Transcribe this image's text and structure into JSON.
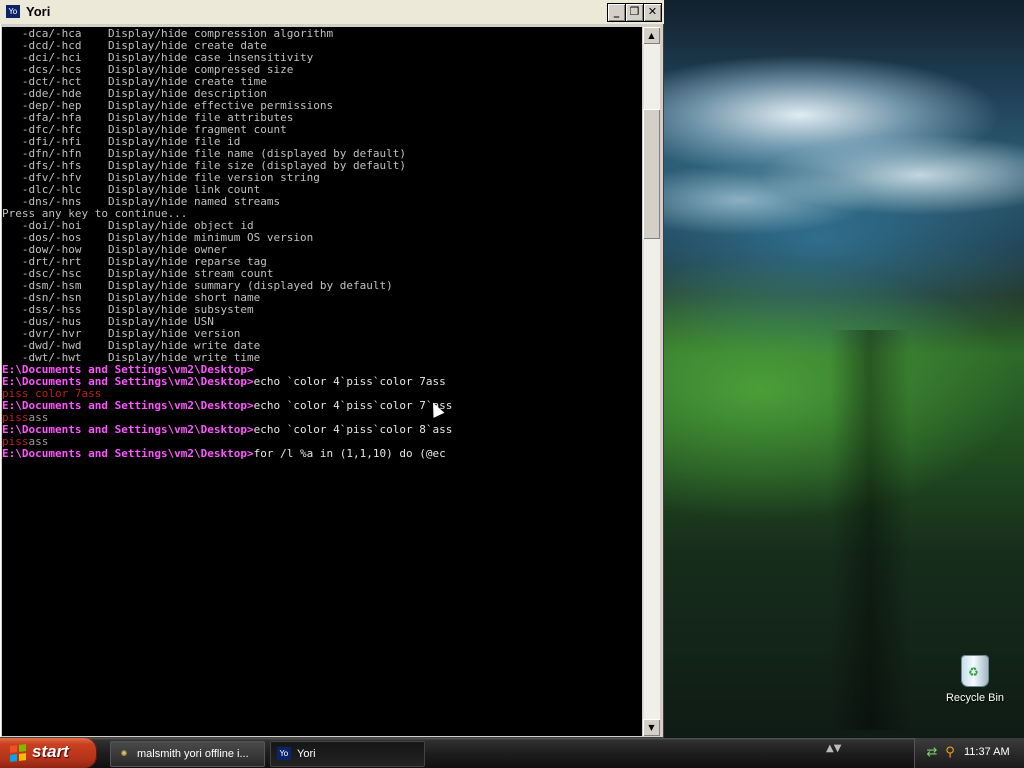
{
  "window": {
    "title": "Yori",
    "icon": "yori-app-icon",
    "minimize_glyph": "_",
    "restore_glyph": "❐",
    "close_glyph": "✕"
  },
  "console": {
    "lines": [
      {
        "parts": [
          {
            "t": "   -dca/-hca    Display/hide compression algorithm",
            "c": "out"
          }
        ]
      },
      {
        "parts": [
          {
            "t": "   -dcd/-hcd    Display/hide create date",
            "c": "out"
          }
        ]
      },
      {
        "parts": [
          {
            "t": "   -dci/-hci    Display/hide case insensitivity",
            "c": "out"
          }
        ]
      },
      {
        "parts": [
          {
            "t": "   -dcs/-hcs    Display/hide compressed size",
            "c": "out"
          }
        ]
      },
      {
        "parts": [
          {
            "t": "   -dct/-hct    Display/hide create time",
            "c": "out"
          }
        ]
      },
      {
        "parts": [
          {
            "t": "   -dde/-hde    Display/hide description",
            "c": "out"
          }
        ]
      },
      {
        "parts": [
          {
            "t": "   -dep/-hep    Display/hide effective permissions",
            "c": "out"
          }
        ]
      },
      {
        "parts": [
          {
            "t": "   -dfa/-hfa    Display/hide file attributes",
            "c": "out"
          }
        ]
      },
      {
        "parts": [
          {
            "t": "   -dfc/-hfc    Display/hide fragment count",
            "c": "out"
          }
        ]
      },
      {
        "parts": [
          {
            "t": "   -dfi/-hfi    Display/hide file id",
            "c": "out"
          }
        ]
      },
      {
        "parts": [
          {
            "t": "   -dfn/-hfn    Display/hide file name (displayed by default)",
            "c": "out"
          }
        ]
      },
      {
        "parts": [
          {
            "t": "   -dfs/-hfs    Display/hide file size (displayed by default)",
            "c": "out"
          }
        ]
      },
      {
        "parts": [
          {
            "t": "   -dfv/-hfv    Display/hide file version string",
            "c": "out"
          }
        ]
      },
      {
        "parts": [
          {
            "t": "   -dlc/-hlc    Display/hide link count",
            "c": "out"
          }
        ]
      },
      {
        "parts": [
          {
            "t": "   -dns/-hns    Display/hide named streams",
            "c": "out"
          }
        ]
      },
      {
        "parts": [
          {
            "t": "Press any key to continue...",
            "c": "out"
          }
        ]
      },
      {
        "parts": [
          {
            "t": "   -doi/-hoi    Display/hide object id",
            "c": "out"
          }
        ]
      },
      {
        "parts": [
          {
            "t": "   -dos/-hos    Display/hide minimum OS version",
            "c": "out"
          }
        ]
      },
      {
        "parts": [
          {
            "t": "   -dow/-how    Display/hide owner",
            "c": "out"
          }
        ]
      },
      {
        "parts": [
          {
            "t": "   -drt/-hrt    Display/hide reparse tag",
            "c": "out"
          }
        ]
      },
      {
        "parts": [
          {
            "t": "   -dsc/-hsc    Display/hide stream count",
            "c": "out"
          }
        ]
      },
      {
        "parts": [
          {
            "t": "   -dsm/-hsm    Display/hide summary (displayed by default)",
            "c": "out"
          }
        ]
      },
      {
        "parts": [
          {
            "t": "   -dsn/-hsn    Display/hide short name",
            "c": "out"
          }
        ]
      },
      {
        "parts": [
          {
            "t": "   -dss/-hss    Display/hide subsystem",
            "c": "out"
          }
        ]
      },
      {
        "parts": [
          {
            "t": "   -dus/-hus    Display/hide USN",
            "c": "out"
          }
        ]
      },
      {
        "parts": [
          {
            "t": "   -dvr/-hvr    Display/hide version",
            "c": "out"
          }
        ]
      },
      {
        "parts": [
          {
            "t": "   -dwd/-hwd    Display/hide write date",
            "c": "out"
          }
        ]
      },
      {
        "parts": [
          {
            "t": "   -dwt/-hwt    Display/hide write time",
            "c": "out"
          }
        ]
      },
      {
        "parts": [
          {
            "t": "E:\\Documents and Settings\\vm2\\Desktop>",
            "c": "prompt"
          }
        ]
      },
      {
        "parts": [
          {
            "t": "E:\\Documents and Settings\\vm2\\Desktop>",
            "c": "prompt"
          },
          {
            "t": "echo `color 4`piss`color 7ass",
            "c": "cmd"
          }
        ]
      },
      {
        "parts": [
          {
            "t": "piss color 7ass",
            "c": "red"
          }
        ]
      },
      {
        "parts": [
          {
            "t": "E:\\Documents and Settings\\vm2\\Desktop>",
            "c": "prompt"
          },
          {
            "t": "echo `color 4`piss`color 7`ass",
            "c": "cmd"
          }
        ]
      },
      {
        "parts": [
          {
            "t": "piss",
            "c": "red"
          },
          {
            "t": "ass",
            "c": "grey"
          }
        ]
      },
      {
        "parts": [
          {
            "t": "E:\\Documents and Settings\\vm2\\Desktop>",
            "c": "prompt"
          },
          {
            "t": "echo `color 4`piss`color 8`ass",
            "c": "cmd"
          }
        ]
      },
      {
        "parts": [
          {
            "t": "piss",
            "c": "red"
          },
          {
            "t": "ass",
            "c": "grey"
          }
        ]
      },
      {
        "parts": [
          {
            "t": "E:\\Documents and Settings\\vm2\\Desktop>",
            "c": "prompt"
          },
          {
            "t": "for /l %a in (1,1,10) do (@ec",
            "c": "cmd"
          }
        ]
      }
    ]
  },
  "scrollbar": {
    "up_glyph": "▲",
    "down_glyph": "▼"
  },
  "desktop": {
    "recycle_bin_label": "Recycle Bin",
    "recycle_bin_icon": "recycle-bin-icon"
  },
  "taskbar": {
    "start_label": "start",
    "tasks": [
      {
        "label": "malsmith yori offline i...",
        "icon": "browser-icon",
        "glyph": "✺",
        "active": false
      },
      {
        "label": "Yori",
        "icon": "yori-app-icon",
        "glyph": "Yo",
        "active": true
      }
    ],
    "tray_icons": [
      {
        "name": "network-icon",
        "glyph": "⇄",
        "color": "#7fd06f"
      },
      {
        "name": "search-icon",
        "glyph": "⚲",
        "color": "#f0a020"
      }
    ],
    "clock": "11:37 AM",
    "overflow_glyph": "▲▼"
  },
  "colors": {
    "prompt": "#ff55ff",
    "command": "#e6e6e6",
    "output": "#c0c0c0",
    "red": "#c21e1e",
    "grey": "#9a9a9a",
    "console_bg": "#000000"
  }
}
